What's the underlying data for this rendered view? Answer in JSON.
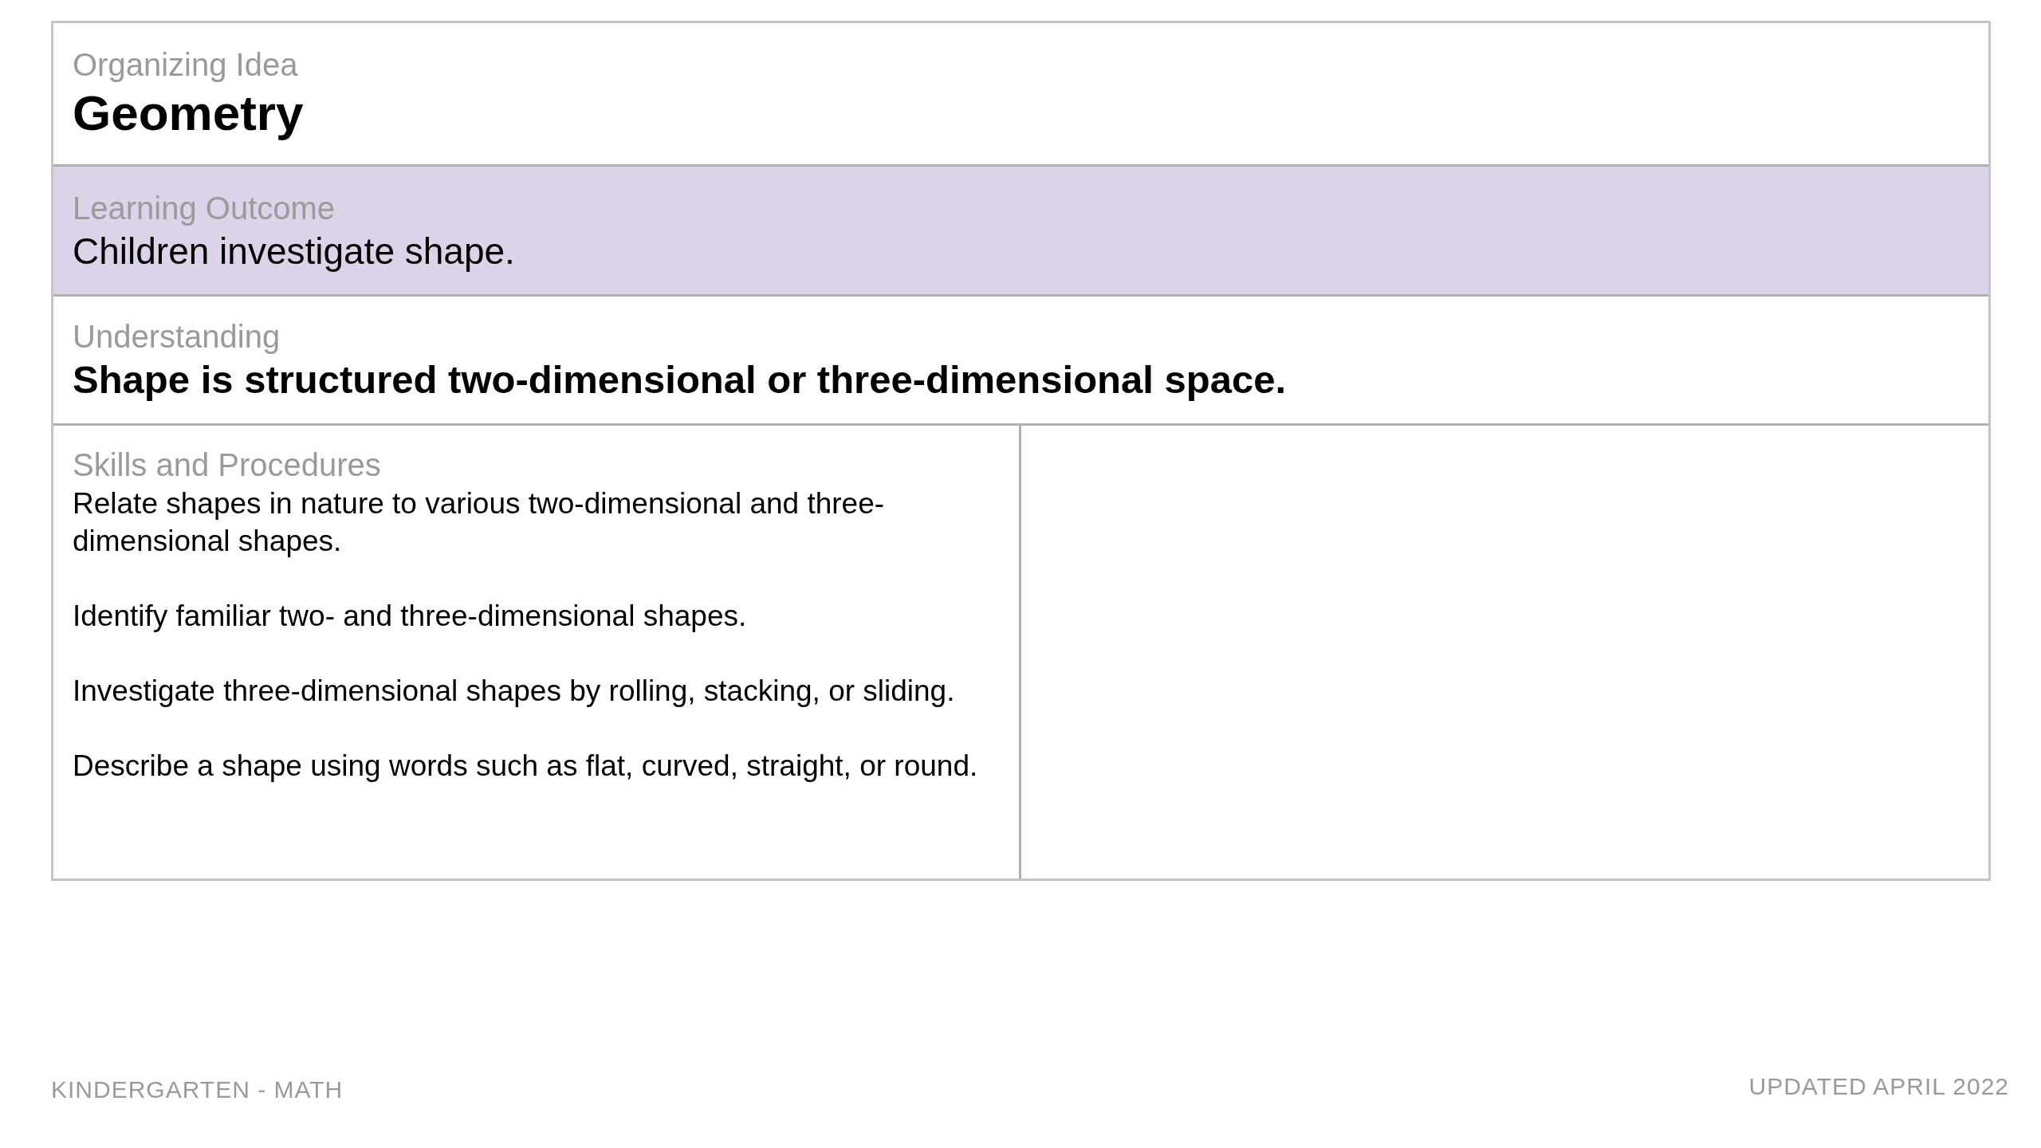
{
  "organizing_idea": {
    "label": "Organizing Idea",
    "value": "Geometry"
  },
  "learning_outcome": {
    "label": "Learning Outcome",
    "value": "Children investigate shape.",
    "highlighted": true
  },
  "understanding": {
    "label": "Understanding",
    "value": "Shape is structured two-dimensional or three-dimensional space."
  },
  "skills": {
    "label": "Skills and Procedures",
    "items": [
      "Relate shapes in nature to various two-dimensional and three-dimensional shapes.",
      "Identify familiar two- and three-dimensional shapes.",
      "Investigate three-dimensional shapes by rolling, stacking, or sliding.",
      "Describe a shape using words such as flat, curved, straight, or round."
    ]
  },
  "footer": {
    "left": "KINDERGARTEN - MATH",
    "right": "UPDATED APRIL 2022"
  }
}
